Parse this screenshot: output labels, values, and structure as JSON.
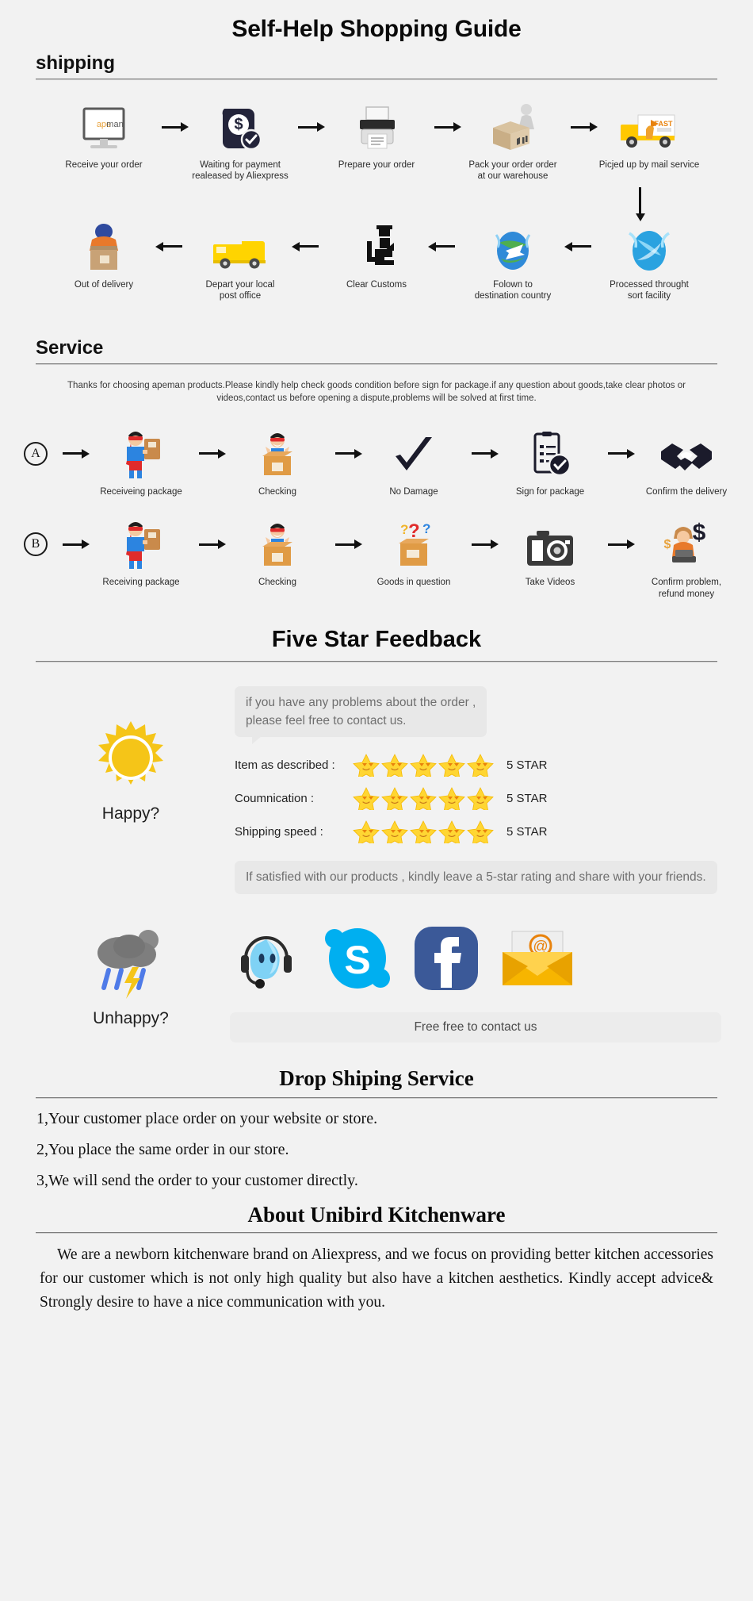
{
  "page": {
    "title": "Self-Help Shopping Guide",
    "background": "#f2f2f2"
  },
  "shipping": {
    "heading": "shipping",
    "row1": [
      {
        "icon": "monitor-apeman-icon",
        "label": "Receive your order"
      },
      {
        "icon": "payment-shield-dollar-icon",
        "label": "Waiting for payment\nrealeased by Aliexpress"
      },
      {
        "icon": "printer-icon",
        "label": "Prepare your order"
      },
      {
        "icon": "worker-packing-box-icon",
        "label": "Pack your order order\nat our warehouse"
      },
      {
        "icon": "fast-delivery-truck-icon",
        "label": "Picjed up by mail service"
      }
    ],
    "row2": [
      {
        "icon": "out-for-delivery-courier-icon",
        "label": "Out of delivery"
      },
      {
        "icon": "yellow-van-icon",
        "label": "Depart your local\npost office"
      },
      {
        "icon": "customs-officer-icon",
        "label": "Clear Customs"
      },
      {
        "icon": "globe-airplane-icon",
        "label": "Folown to\ndestination country"
      },
      {
        "icon": "sort-facility-globe-icon",
        "label": "Processed throught\nsort facility"
      }
    ]
  },
  "service": {
    "heading": "Service",
    "note": "Thanks for choosing apeman products.Please kindly help check goods condition before sign for package.if any question about goods,take clear photos or videos,contact us before opening a dispute,problems will be solved at first time.",
    "rowA": {
      "badge": "A",
      "steps": [
        {
          "icon": "superhero-delivery-icon",
          "label": "Receiveing package"
        },
        {
          "icon": "happy-person-open-box-icon",
          "label": "Checking"
        },
        {
          "icon": "checkmark-icon",
          "label": "No Damage"
        },
        {
          "icon": "signed-document-check-icon",
          "label": "Sign for package"
        },
        {
          "icon": "handshake-icon",
          "label": "Confirm the delivery"
        }
      ]
    },
    "rowB": {
      "badge": "B",
      "steps": [
        {
          "icon": "superhero-delivery-icon",
          "label": "Receiving package"
        },
        {
          "icon": "happy-person-open-box-icon",
          "label": "Checking"
        },
        {
          "icon": "box-question-marks-icon",
          "label": "Goods in question"
        },
        {
          "icon": "camera-icon",
          "label": "Take Videos"
        },
        {
          "icon": "refund-agent-dollar-icon",
          "label": "Confirm problem,\nrefund money"
        }
      ]
    }
  },
  "feedback": {
    "title": "Five Star Feedback",
    "bubble": "if you have any problems about the order ,\nplease feel free to contact us.",
    "happy_label": "Happy?",
    "happy_icon": "sun-icon",
    "ratings": [
      {
        "label": "Item as described :",
        "stars": 5,
        "value": "5 STAR"
      },
      {
        "label": "Coumnication :",
        "stars": 5,
        "value": "5 STAR"
      },
      {
        "label": "Shipping speed :",
        "stars": 5,
        "value": "5 STAR"
      }
    ],
    "satisfied_note": "If satisfied with our products ,  kindly leave\na 5-star rating and share with your friends.",
    "unhappy_label": "Unhappy?",
    "unhappy_icon": "rain-cloud-lightning-icon",
    "socials": [
      {
        "icon": "support-headset-icon",
        "name": "aliexpress-chat"
      },
      {
        "icon": "skype-icon",
        "name": "skype"
      },
      {
        "icon": "facebook-icon",
        "name": "facebook"
      },
      {
        "icon": "email-envelope-icon",
        "name": "email"
      }
    ],
    "contact_bar": "Free free to contact us"
  },
  "dropship": {
    "title": "Drop Shiping Service",
    "items": [
      "1,Your customer place order on your website or store.",
      "2,You place the same order in our store.",
      "3,We will send the order to your customer directly."
    ]
  },
  "about": {
    "title": "About Unibird Kitchenware",
    "paragraph": "We are a newborn kitchenware brand on Aliexpress, and we focus on providing better kitchen accessories for our customer which is not only high quality but also have a kitchen aesthetics. Kindly accept advice& Strongly desire to have a nice communication with you."
  },
  "colors": {
    "star_gold": "#FFD633",
    "star_gold_dark": "#F5B800",
    "sun_gold": "#F5C518",
    "skype_blue": "#00AFF0",
    "facebook_blue": "#3B5998",
    "envelope_yellow": "#FFC107",
    "truck_yellow": "#FFCE00",
    "cloud_gray": "#7E7E7E",
    "rain_blue": "#4F7BE8"
  }
}
